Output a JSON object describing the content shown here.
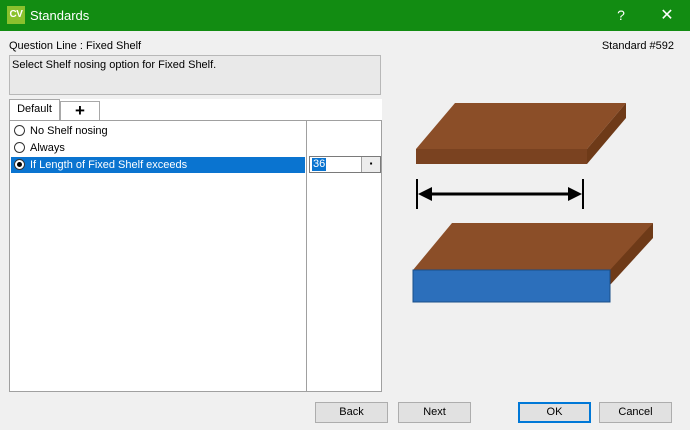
{
  "window": {
    "app_icon_text": "CV",
    "title": "Standards",
    "help_label": "?",
    "close_label": "✕"
  },
  "header": {
    "question_line": "Question Line : Fixed Shelf",
    "standard_number": "Standard #592",
    "description": "Select Shelf nosing option for Fixed Shelf."
  },
  "tabs": [
    {
      "label": "Default",
      "active": true
    },
    {
      "label": "+",
      "active": false
    }
  ],
  "options": [
    {
      "label": "No Shelf nosing",
      "checked": false,
      "selected": false
    },
    {
      "label": "Always",
      "checked": false,
      "selected": false
    },
    {
      "label": "If Length of Fixed Shelf exceeds",
      "checked": true,
      "selected": true
    }
  ],
  "length_input": {
    "value": "36",
    "dropdown_glyph": "▪"
  },
  "illustration": {
    "shelf_top_color": "#8b4e28",
    "shelf_front_color": "#7a4220",
    "nosing_color": "#2c6fbb",
    "arrow_color": "#000000"
  },
  "buttons": {
    "back": "Back",
    "next": "Next",
    "ok": "OK",
    "cancel": "Cancel"
  },
  "colors": {
    "titlebar": "#128c12",
    "selection": "#0a74d0"
  }
}
